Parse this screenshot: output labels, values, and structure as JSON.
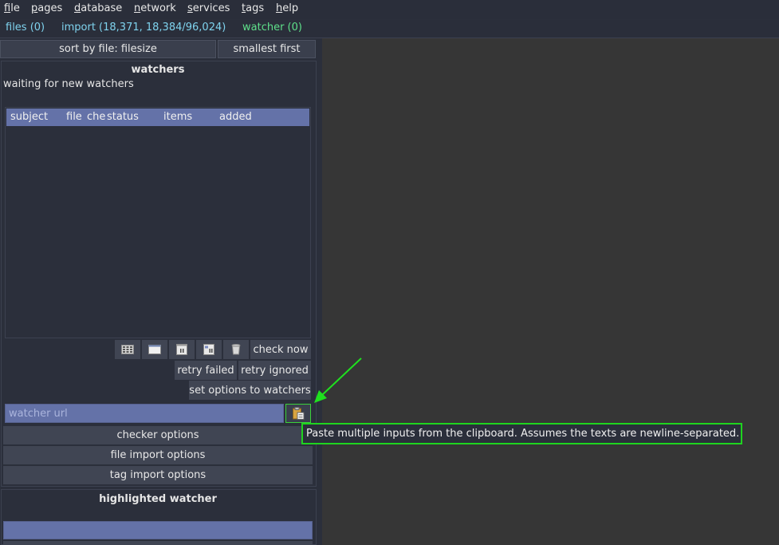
{
  "menu": [
    {
      "underline": "f",
      "rest": "ile"
    },
    {
      "underline": "p",
      "rest": "ages"
    },
    {
      "underline": "d",
      "rest": "atabase"
    },
    {
      "underline": "n",
      "rest": "etwork"
    },
    {
      "underline": "s",
      "rest": "ervices"
    },
    {
      "underline": "t",
      "rest": "ags"
    },
    {
      "underline": "h",
      "rest": "elp"
    }
  ],
  "status": {
    "files": "files (0)",
    "import": "import (18,371, 18,384/96,024)",
    "watcher": "watcher (0)"
  },
  "sort": {
    "by": "sort by file: filesize",
    "order": "smallest first"
  },
  "watchers": {
    "title": "watchers",
    "status_text": "waiting for new watchers",
    "columns": [
      "subject",
      "file",
      "che",
      "status",
      "items",
      "added"
    ],
    "check_now": "check now",
    "retry_failed": "retry failed",
    "retry_ignored": "retry ignored",
    "set_options": "set options to watchers",
    "url_placeholder": "watcher url",
    "checker_options": "checker options",
    "file_import_options": "file import options",
    "tag_import_options": "tag import options"
  },
  "tooltip": "Paste multiple inputs from the clipboard. Assumes the texts are newline-separated.",
  "highlighted": {
    "title": "highlighted watcher"
  },
  "icons": [
    "grid-icon",
    "window-icon",
    "pause-page-icon",
    "pause-files-icon",
    "trash-icon",
    "clipboard-paste-icon"
  ],
  "colors": {
    "accent": "#6472a8",
    "tooltip_border": "#1fd41f",
    "files_status": "#7fd3ee",
    "watcher_status": "#5ee08a"
  }
}
